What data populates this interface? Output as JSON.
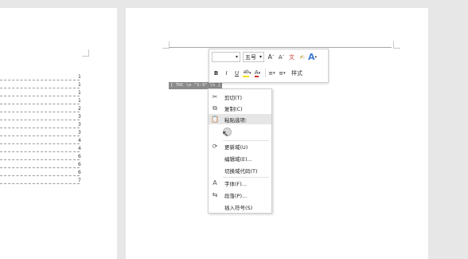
{
  "left_page": {
    "toc_numbers": [
      "1",
      "1",
      "1",
      "1",
      "2",
      "3",
      "3",
      "3",
      "4",
      "4",
      "6",
      "6",
      "6",
      "7"
    ]
  },
  "field_code": {
    "text": "{ TOC \\o \"1-3\" \\h }"
  },
  "mini_toolbar": {
    "font_name": "",
    "font_size": "五号",
    "grow_font": "A",
    "shrink_font": "A",
    "phonetic_guide": "文",
    "format_painter": "✍",
    "text_effects": "A",
    "bold": "B",
    "italic": "I",
    "underline": "U",
    "highlight": "ab",
    "font_color": "A",
    "bullets": "≡",
    "numbering": "≡",
    "styles": "样式"
  },
  "context_menu": {
    "items": [
      {
        "label": "剪切(T)",
        "icon": "cut-icon"
      },
      {
        "label": "复制(C)",
        "icon": "copy-icon"
      },
      {
        "label": "粘贴选项:",
        "icon": "paste-icon"
      },
      {
        "label": "更新域(U)",
        "icon": "update-field-icon"
      },
      {
        "label": "编辑域(E)...",
        "icon": ""
      },
      {
        "label": "切换域代码(T)",
        "icon": ""
      },
      {
        "label": "字体(F)...",
        "icon": "font-icon"
      },
      {
        "label": "段落(P)...",
        "icon": "paragraph-icon"
      },
      {
        "label": "插入符号(S)",
        "icon": ""
      }
    ]
  },
  "colors": {
    "highlight": "#f5e400",
    "font_color": "#d62b2b",
    "text_effects": "#3a7bd5",
    "field_code_bg": "#8a8a8a"
  }
}
